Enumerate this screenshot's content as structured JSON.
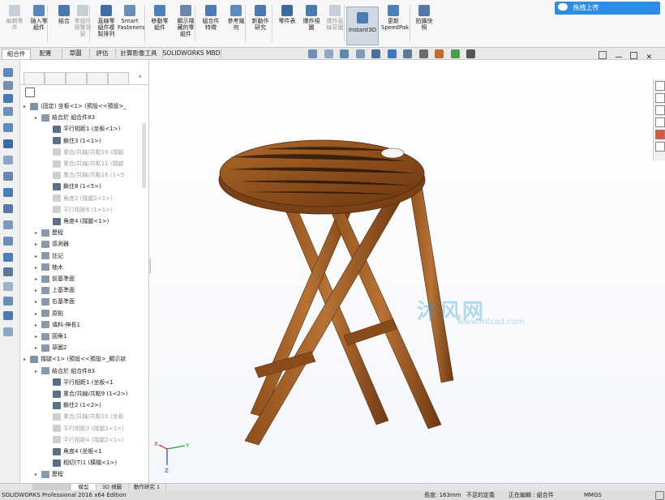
{
  "ribbon": {
    "buttons": [
      {
        "label": "編輯零\n件",
        "dim": true
      },
      {
        "label": "插入零\n組件",
        "dim": false
      },
      {
        "label": "結合",
        "dim": false
      },
      {
        "label": "零組件\n預覽視\n窗",
        "dim": true
      },
      {
        "label": "直線零\n組件複\n製排列",
        "dim": false
      },
      {
        "label": "Smart\nFasteners",
        "dim": false
      },
      {
        "label": "移動零\n組件",
        "dim": false
      },
      {
        "label": "顯示隱\n藏的零\n組件",
        "dim": false
      },
      {
        "label": "組合件\n特徵",
        "dim": false
      },
      {
        "label": "參考幾\n何",
        "dim": false
      },
      {
        "label": "新動作\n研究",
        "dim": false
      },
      {
        "label": "零件表",
        "dim": false
      },
      {
        "label": "爆炸視\n圖",
        "dim": false
      },
      {
        "label": "爆炸直\n線草圖",
        "dim": true
      },
      {
        "label": "Instant3D",
        "dim": false
      },
      {
        "label": "更新\nSpeedPak",
        "dim": false
      },
      {
        "label": "拍攝快\n照",
        "dim": false
      }
    ],
    "upload_label": "拖拽上传"
  },
  "tabs": [
    "組合件",
    "配置",
    "草圖",
    "評估",
    "計算影像工具",
    "SOLIDWORKS MBD"
  ],
  "tree": {
    "rows": [
      {
        "label": "(固定) 坐板<1> (預設<<預設>_",
        "indent": 0,
        "dim": false
      },
      {
        "label": "結合於 組合件83",
        "indent": 1,
        "dim": false
      },
      {
        "label": "平行相距1 (坐板<1>)",
        "indent": 2,
        "dim": false
      },
      {
        "label": "鎖住3 (1<1>)",
        "indent": 2,
        "dim": false
      },
      {
        "label": "重合/共線/共點10 (撐腿",
        "indent": 2,
        "dim": true
      },
      {
        "label": "重合/共線/共點11 (撐腿",
        "indent": 2,
        "dim": true
      },
      {
        "label": "重合/共線/共點16 (1<5",
        "indent": 2,
        "dim": true
      },
      {
        "label": "鎖住8 (1<5>)",
        "indent": 2,
        "dim": false
      },
      {
        "label": "角度2 (撐腿2<1>)",
        "indent": 2,
        "dim": true
      },
      {
        "label": "平行相距6 (1<1>)",
        "indent": 2,
        "dim": true
      },
      {
        "label": "角度4 (撐腿<1>)",
        "indent": 2,
        "dim": false
      },
      {
        "label": "歷程",
        "indent": 1,
        "dim": false
      },
      {
        "label": "感測器",
        "indent": 1,
        "dim": false
      },
      {
        "label": "註記",
        "indent": 1,
        "dim": false
      },
      {
        "label": "柚木",
        "indent": 1,
        "dim": false
      },
      {
        "label": "前基準面",
        "indent": 1,
        "dim": false
      },
      {
        "label": "上基準面",
        "indent": 1,
        "dim": false
      },
      {
        "label": "右基準面",
        "indent": 1,
        "dim": false
      },
      {
        "label": "原點",
        "indent": 1,
        "dim": false
      },
      {
        "label": "填料-伸長1",
        "indent": 1,
        "dim": false
      },
      {
        "label": "圓角1",
        "indent": 1,
        "dim": false
      },
      {
        "label": "草圖2",
        "indent": 1,
        "dim": false
      },
      {
        "label": "撐腿<1> (預設<<預設>_顯示狀",
        "indent": 0,
        "dim": false
      },
      {
        "label": "結合於 組合件83",
        "indent": 1,
        "dim": false
      },
      {
        "label": "平行相距1 (坐板<1",
        "indent": 2,
        "dim": false
      },
      {
        "label": "重合/共線/共點9 (1<2>)",
        "indent": 2,
        "dim": false
      },
      {
        "label": "鎖住2 (1<2>)",
        "indent": 2,
        "dim": false
      },
      {
        "label": "重合/共線/共點10 (坐板",
        "indent": 2,
        "dim": true
      },
      {
        "label": "平行相距3 (撐腿2<1>)",
        "indent": 2,
        "dim": true
      },
      {
        "label": "平行相距4 (撐腿2<1>)",
        "indent": 2,
        "dim": true
      },
      {
        "label": "角度4 (坐板<1",
        "indent": 2,
        "dim": false
      },
      {
        "label": "相切(T)1 (橫檔<1>)",
        "indent": 2,
        "dim": false
      },
      {
        "label": "歷程",
        "indent": 1,
        "dim": false
      }
    ]
  },
  "viewport": {
    "watermark": "沐风网",
    "watermark_url": "www.mfcad.com",
    "triad": {
      "x": "X",
      "y": "Y",
      "z": "Z"
    }
  },
  "bottom_tabs": [
    "模型",
    "3D 視圖",
    "動作研究 1"
  ],
  "status": {
    "app": "SOLIDWORKS Professional 2016 x64 Edition",
    "length": "長度: 163mm",
    "defined": "不足的定義",
    "editing": "正在編輯 : 組合件",
    "units": "MMGS"
  },
  "colors": {
    "accent": "#2d8ce3",
    "wood": "#9b5b22",
    "wood_dark": "#6b3a12"
  }
}
